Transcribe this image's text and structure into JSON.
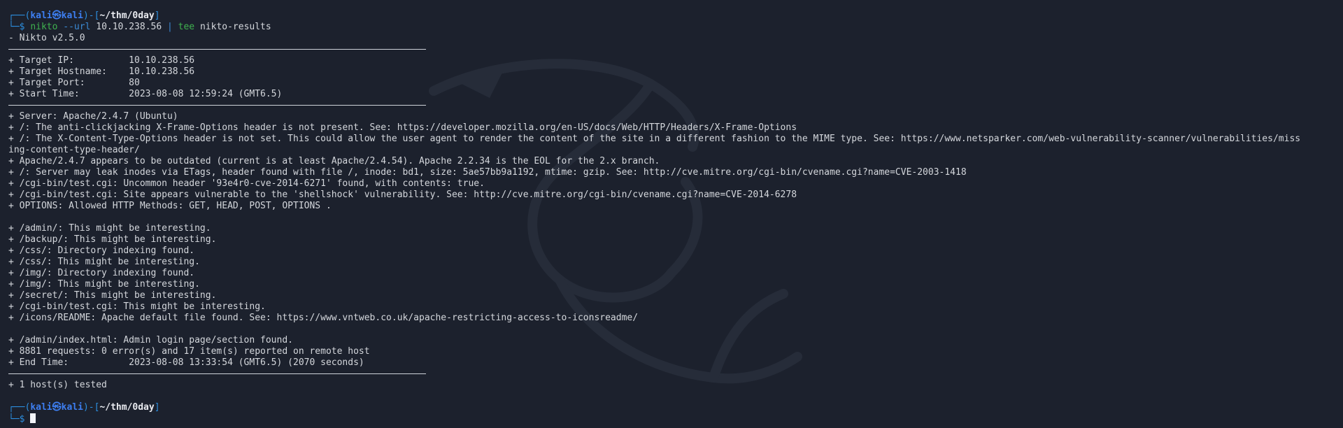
{
  "prompt": {
    "box_top": "┌──(",
    "user": "kali㉿kali",
    "mid": ")-[",
    "path": "~/thm/0day",
    "end": "]",
    "box_bottom": "└─$ "
  },
  "command": {
    "name": "nikto",
    "option": "--url",
    "target": "10.10.238.56",
    "pipe": "|",
    "tee": "tee",
    "outfile": "nikto-results"
  },
  "output": {
    "version": "- Nikto v2.5.0",
    "target_ip": "+ Target IP:          10.10.238.56",
    "target_hostname": "+ Target Hostname:    10.10.238.56",
    "target_port": "+ Target Port:        80",
    "start_time": "+ Start Time:         2023-08-08 12:59:24 (GMT6.5)",
    "findings": [
      "+ Server: Apache/2.4.7 (Ubuntu)",
      "+ /: The anti-clickjacking X-Frame-Options header is not present. See: https://developer.mozilla.org/en-US/docs/Web/HTTP/Headers/X-Frame-Options",
      "+ /: The X-Content-Type-Options header is not set. This could allow the user agent to render the content of the site in a different fashion to the MIME type. See: https://www.netsparker.com/web-vulnerability-scanner/vulnerabilities/miss",
      "ing-content-type-header/",
      "+ Apache/2.4.7 appears to be outdated (current is at least Apache/2.4.54). Apache 2.2.34 is the EOL for the 2.x branch.",
      "+ /: Server may leak inodes via ETags, header found with file /, inode: bd1, size: 5ae57bb9a1192, mtime: gzip. See: http://cve.mitre.org/cgi-bin/cvename.cgi?name=CVE-2003-1418",
      "+ /cgi-bin/test.cgi: Uncommon header '93e4r0-cve-2014-6271' found, with contents: true.",
      "+ /cgi-bin/test.cgi: Site appears vulnerable to the 'shellshock' vulnerability. See: http://cve.mitre.org/cgi-bin/cvename.cgi?name=CVE-2014-6278",
      "+ OPTIONS: Allowed HTTP Methods: GET, HEAD, POST, OPTIONS ."
    ],
    "dirs": [
      "+ /admin/: This might be interesting.",
      "+ /backup/: This might be interesting.",
      "+ /css/: Directory indexing found.",
      "+ /css/: This might be interesting.",
      "+ /img/: Directory indexing found.",
      "+ /img/: This might be interesting.",
      "+ /secret/: This might be interesting.",
      "+ /cgi-bin/test.cgi: This might be interesting.",
      "+ /icons/README: Apache default file found. See: https://www.vntweb.co.uk/apache-restricting-access-to-iconsreadme/"
    ],
    "summary": [
      "+ /admin/index.html: Admin login page/section found.",
      "+ 8881 requests: 0 error(s) and 17 item(s) reported on remote host",
      "+ End Time:           2023-08-08 13:33:54 (GMT6.5) (2070 seconds)"
    ],
    "hosts_tested": "+ 1 host(s) tested"
  },
  "colors": {
    "background": "#1c212d",
    "text": "#d4d7dc",
    "prompt_blue": "#3d7ef0",
    "command_green": "#3fb24f"
  }
}
